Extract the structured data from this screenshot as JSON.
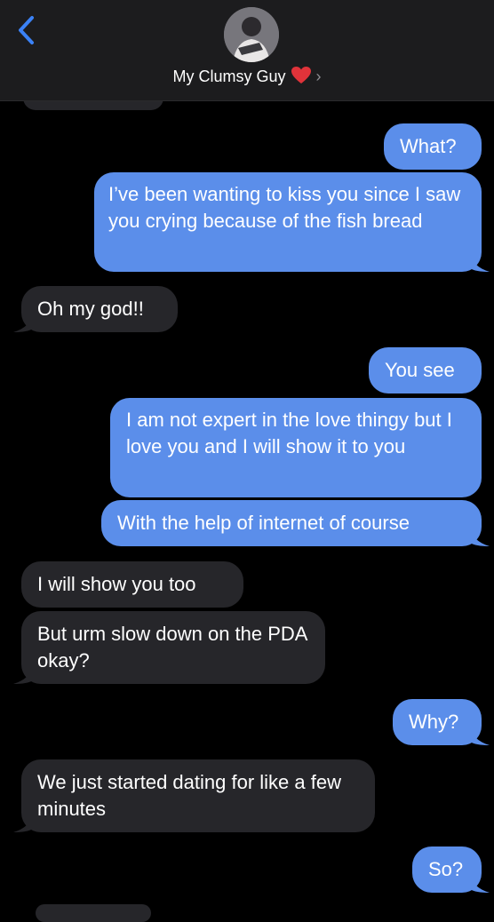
{
  "header": {
    "contact_name": "My Clumsy Guy",
    "back_icon": "chevron-left-icon",
    "heart_icon": "red-heart-icon",
    "chevron": "›"
  },
  "colors": {
    "sent_bubble": "#5b8eea",
    "received_bubble": "#26262a",
    "background": "#000000",
    "accent": "#3b82f6"
  },
  "messages": [
    {
      "side": "out",
      "text": "What?"
    },
    {
      "side": "out",
      "text": "I’ve been wanting to kiss you since I saw you crying because of the fish bread"
    },
    {
      "side": "in",
      "text": "Oh my god!!"
    },
    {
      "side": "out",
      "text": "You see"
    },
    {
      "side": "out",
      "text": "I am not expert in the love thingy but I love you and I will show it to you"
    },
    {
      "side": "out",
      "text": "With the help of internet of course"
    },
    {
      "side": "in",
      "text": "I will show you too"
    },
    {
      "side": "in",
      "text": "But urm slow down on the PDA okay?"
    },
    {
      "side": "out",
      "text": "Why?"
    },
    {
      "side": "in",
      "text": "We just started dating for like a few minutes"
    },
    {
      "side": "out",
      "text": "So?"
    }
  ]
}
